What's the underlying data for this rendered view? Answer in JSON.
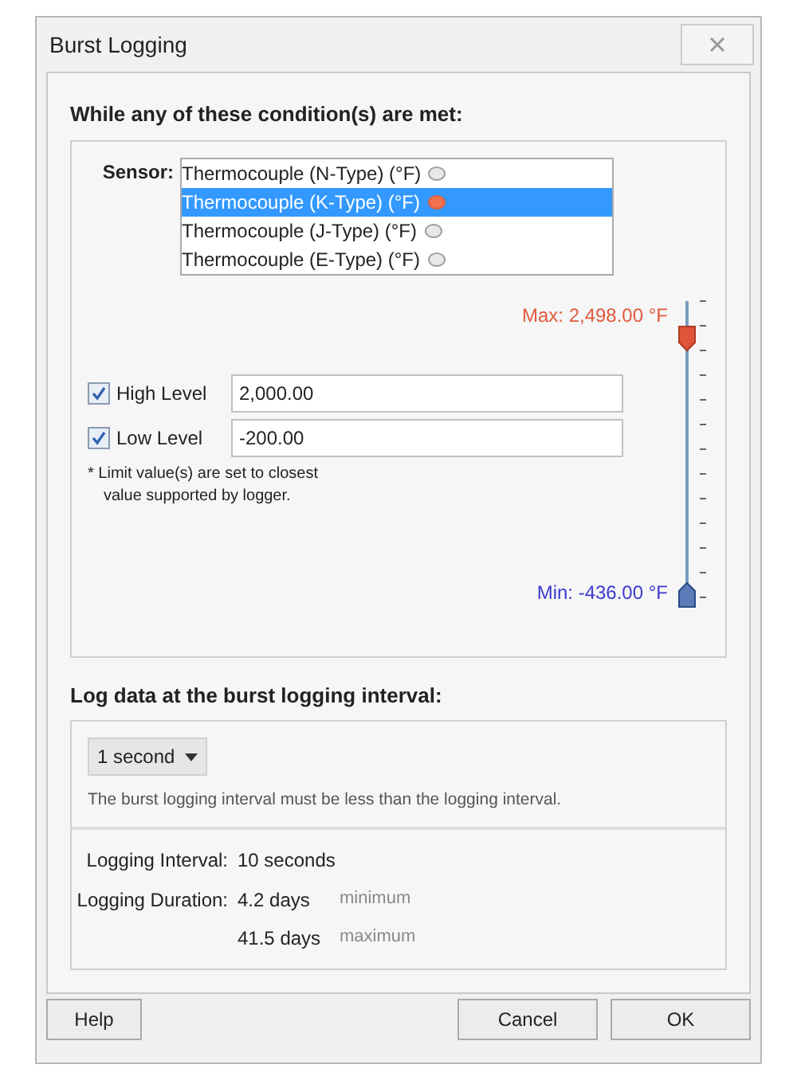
{
  "window": {
    "title": "Burst Logging"
  },
  "conditions": {
    "heading": "While any of these condition(s) are met:",
    "sensor_label": "Sensor:",
    "sensors": [
      {
        "label": "Thermocouple (N-Type) (°F)",
        "selected": false
      },
      {
        "label": "Thermocouple (K-Type) (°F)",
        "selected": true
      },
      {
        "label": "Thermocouple (J-Type) (°F)",
        "selected": false
      },
      {
        "label": "Thermocouple (E-Type) (°F)",
        "selected": false
      }
    ],
    "max_label": "Max: 2,498.00 °F",
    "min_label": "Min: -436.00 °F",
    "limits": [
      {
        "label": "High Level",
        "checked": true,
        "value": "2,000.00"
      },
      {
        "label": "Low Level",
        "checked": true,
        "value": "-200.00"
      }
    ],
    "note_lines": [
      "* Limit value(s) are set to closest",
      "value supported by logger."
    ]
  },
  "interval": {
    "heading": "Log data at the burst logging interval:",
    "dropdown": "1 second",
    "note": "The burst logging interval must be less than the logging interval.",
    "logging_interval_label": "Logging Interval:",
    "logging_interval_value": "10 seconds",
    "logging_duration_label": "Logging Duration:",
    "durations": [
      {
        "value": "4.2 days",
        "qualifier": "minimum"
      },
      {
        "value": "41.5 days",
        "qualifier": "maximum"
      }
    ]
  },
  "buttons": {
    "help": "Help",
    "cancel": "Cancel",
    "ok": "OK"
  }
}
